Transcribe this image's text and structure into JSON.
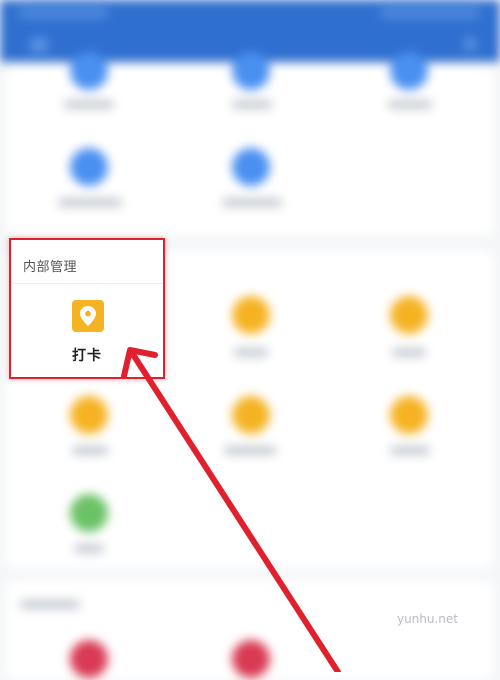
{
  "section": {
    "title": "内部管理",
    "items": [
      {
        "label": "打卡",
        "icon": "location-pin-icon"
      }
    ]
  },
  "watermark": "yunhu.net",
  "colors": {
    "header": "#2f6fcf",
    "accent_yellow": "#f5b323",
    "annotation_red": "#e0212d"
  }
}
